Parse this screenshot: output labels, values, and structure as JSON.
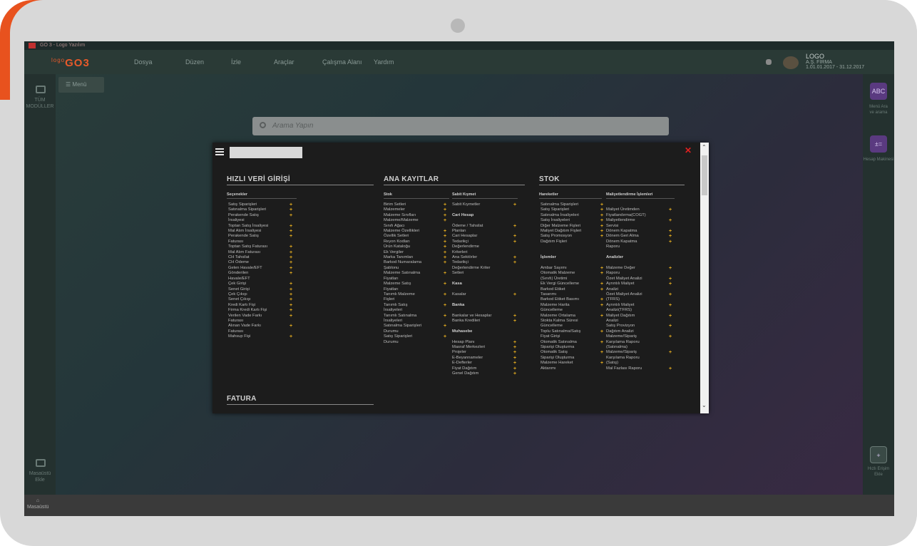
{
  "app": {
    "title": "GO 3 - Logo Yazılım",
    "logo_text": "GO3",
    "logo_prefix": "logo",
    "menu": [
      "Dosya",
      "Düzen",
      "İzle",
      "Araçlar",
      "Çalışma Alanı",
      "Yardım"
    ],
    "user": {
      "name": "LOGO",
      "company": "A.Ş. FİRMA",
      "date": "1.01.01.2017 - 31.12.2017"
    }
  },
  "leftbar": {
    "items": [
      {
        "label": "TÜM MODÜLLER",
        "icon": "monitor-icon"
      },
      {
        "label": "Masaüstü Ekle",
        "icon": "desktop-add-icon"
      }
    ]
  },
  "rightbar": {
    "items": [
      {
        "label": "Menü Ara",
        "sub": "ve arama",
        "icon": "abc-icon"
      },
      {
        "label": "Hesap Makinesi",
        "icon": "calculator-icon"
      },
      {
        "label": "Hızlı Erişim",
        "sub": "Ekle",
        "icon": "quick-add-icon"
      }
    ]
  },
  "menu_button": "Menü",
  "search": {
    "placeholder": "Arama Yapın"
  },
  "taskbar": {
    "home_label": "Masaüstü"
  },
  "modal": {
    "search_value": "",
    "sections": [
      {
        "title": "HIZLI VERİ GİRİŞİ",
        "columns": [
          {
            "heading": "Seçenekler",
            "items": [
              {
                "t": "Satış Siparişleri",
                "plus": true
              },
              {
                "t": "Satınalma Siparişleri",
                "plus": true
              },
              {
                "t": "Perakende Satış",
                "plus": true
              },
              {
                "t": "İrsaliyesi",
                "plus": false
              },
              {
                "t": "Toptan Satış İrsaliyesi",
                "plus": true
              },
              {
                "t": "Mal Alım İrsaliyesi",
                "plus": true
              },
              {
                "t": "Perakende Satış",
                "plus": true
              },
              {
                "t": "Faturası",
                "plus": false
              },
              {
                "t": "Toptan Satış Faturası",
                "plus": true
              },
              {
                "t": "Mal Alım Faturası",
                "plus": true
              },
              {
                "t": "CH Tahsilat",
                "plus": true
              },
              {
                "t": "CH Ödeme",
                "plus": true
              },
              {
                "t": "Gelen Havale/EFT",
                "plus": true
              },
              {
                "t": "Gönderilen",
                "plus": true
              },
              {
                "t": "Havale/EFT",
                "plus": false
              },
              {
                "t": "Çek Girişi",
                "plus": true
              },
              {
                "t": "Senet Girişi",
                "plus": true
              },
              {
                "t": "Çek Çıkışı",
                "plus": true
              },
              {
                "t": "Senet Çıkışı",
                "plus": true
              },
              {
                "t": "Kredi Kartı Fişi",
                "plus": true
              },
              {
                "t": "Firma Kredi Kartı Fişi",
                "plus": true
              },
              {
                "t": "Verilen Vade Farkı",
                "plus": true
              },
              {
                "t": "Faturası",
                "plus": false
              },
              {
                "t": "Alınan Vade Farkı",
                "plus": true
              },
              {
                "t": "Faturası",
                "plus": false
              },
              {
                "t": "Mahsup Fişi",
                "plus": true
              }
            ]
          }
        ]
      },
      {
        "title": "ANA KAYITLAR",
        "columns": [
          {
            "heading": "Stok",
            "items": [
              {
                "t": "Birim Setleri",
                "plus": true
              },
              {
                "t": "Malzemeler",
                "plus": true
              },
              {
                "t": "Malzeme Sınıfları",
                "plus": true
              },
              {
                "t": "Malzeme/Malzeme",
                "plus": true
              },
              {
                "t": "Sınıfı Ağacı",
                "plus": false
              },
              {
                "t": "Malzeme Özellikleri",
                "plus": true
              },
              {
                "t": "Özellik Setleri",
                "plus": true
              },
              {
                "t": "Reyon Kodları",
                "plus": true
              },
              {
                "t": "Ürün Kataloğu",
                "plus": true
              },
              {
                "t": "Ek Vergiler",
                "plus": true
              },
              {
                "t": "Marka Tanımları",
                "plus": true
              },
              {
                "t": "Barkod Numaralama",
                "plus": true
              },
              {
                "t": "Şablonu",
                "plus": false
              },
              {
                "t": "Malzeme Satınalma",
                "plus": true
              },
              {
                "t": "Fiyatları",
                "plus": false
              },
              {
                "t": "Malzeme Satış",
                "plus": true
              },
              {
                "t": "Fiyatları",
                "plus": false
              },
              {
                "t": "Tanımlı Malzeme",
                "plus": true
              },
              {
                "t": "Fişleri",
                "plus": false
              },
              {
                "t": "Tanımlı Satış",
                "plus": true
              },
              {
                "t": "İrsaliyeleri",
                "plus": false
              },
              {
                "t": "Tanımlı Satınalma",
                "plus": true
              },
              {
                "t": "İrsaliyeleri",
                "plus": false
              },
              {
                "t": "Satınalma Siparişleri",
                "plus": true
              },
              {
                "t": "Durumu",
                "plus": false
              },
              {
                "t": "Satış Siparişleri",
                "plus": true
              },
              {
                "t": "Durumu",
                "plus": false
              }
            ]
          },
          {
            "heading": "Sabit Kıymet",
            "items": [
              {
                "t": "Sabit Kıymetler",
                "plus": true
              },
              {
                "t": "",
                "plus": false
              },
              {
                "t": "Cari Hesap",
                "plus": false,
                "head": true
              },
              {
                "t": "",
                "plus": false
              },
              {
                "t": "Ödeme / Tahsilat",
                "plus": true
              },
              {
                "t": "Planları",
                "plus": false
              },
              {
                "t": "Cari Hesaplar",
                "plus": true
              },
              {
                "t": "Tedarikçi",
                "plus": true
              },
              {
                "t": "Değerlendirme",
                "plus": false
              },
              {
                "t": "Kriterleri",
                "plus": false
              },
              {
                "t": "Ana Sektörler",
                "plus": true
              },
              {
                "t": "Tedarikçi",
                "plus": true
              },
              {
                "t": "Değerlendirme Kriter",
                "plus": false
              },
              {
                "t": "Setleri",
                "plus": false
              },
              {
                "t": "",
                "plus": false
              },
              {
                "t": "Kasa",
                "plus": false,
                "head": true
              },
              {
                "t": "",
                "plus": false
              },
              {
                "t": "Kasalar",
                "plus": true
              },
              {
                "t": "",
                "plus": false
              },
              {
                "t": "Banka",
                "plus": false,
                "head": true
              },
              {
                "t": "",
                "plus": false
              },
              {
                "t": "Bankalar ve Hesaplar",
                "plus": true
              },
              {
                "t": "Banka Kredileri",
                "plus": true
              },
              {
                "t": "",
                "plus": false
              },
              {
                "t": "Muhasebe",
                "plus": false,
                "head": true
              },
              {
                "t": "",
                "plus": false
              },
              {
                "t": "Hesap Planı",
                "plus": true
              },
              {
                "t": "Masraf Merkezleri",
                "plus": true
              },
              {
                "t": "Projeler",
                "plus": true
              },
              {
                "t": "E-Beyannameler",
                "plus": true
              },
              {
                "t": "E-Defterler",
                "plus": true
              },
              {
                "t": "Fiyat Dağıtım",
                "plus": true
              },
              {
                "t": "Genel Dağıtım",
                "plus": true
              }
            ]
          }
        ]
      },
      {
        "title": "STOK",
        "columns": [
          {
            "heading": "Hareketler",
            "items": [
              {
                "t": "Satınalma Siparişleri",
                "plus": true
              },
              {
                "t": "Satış Siparişleri",
                "plus": true
              },
              {
                "t": "Satınalma İrsaliyeleri",
                "plus": true
              },
              {
                "t": "Satış İrsaliyeleri",
                "plus": true
              },
              {
                "t": "Diğer Malzeme Fişleri",
                "plus": true
              },
              {
                "t": "Maliyet Dağıtım Fişleri",
                "plus": true
              },
              {
                "t": "Satış Promosyon",
                "plus": true
              },
              {
                "t": "Dağıtım Fişleri",
                "plus": false
              },
              {
                "t": "",
                "plus": false
              },
              {
                "t": "",
                "plus": false
              },
              {
                "t": "İşlemler",
                "plus": false,
                "head": true
              },
              {
                "t": "",
                "plus": false
              },
              {
                "t": "Ambar Sayımı",
                "plus": true
              },
              {
                "t": "Otomatik Malzeme",
                "plus": true
              },
              {
                "t": "(Sınıfı) Üretimi",
                "plus": false
              },
              {
                "t": "Ek Vergi Güncelleme",
                "plus": true
              },
              {
                "t": "Barkod Etiket",
                "plus": true
              },
              {
                "t": "Tasarımı",
                "plus": false
              },
              {
                "t": "Barkod Etiket Basımı",
                "plus": true
              },
              {
                "t": "Malzeme Harita",
                "plus": true
              },
              {
                "t": "Güncelleme",
                "plus": false
              },
              {
                "t": "Malzeme Ortalama",
                "plus": true
              },
              {
                "t": "Stokta Kalma Süresi",
                "plus": false
              },
              {
                "t": "Güncelleme",
                "plus": false
              },
              {
                "t": "Toplu Satınalma/Satış",
                "plus": true
              },
              {
                "t": "Fiyat Girişi",
                "plus": false
              },
              {
                "t": "Otomatik Satınalma",
                "plus": true
              },
              {
                "t": "Siparişi Oluşturma",
                "plus": false
              },
              {
                "t": "Otomatik Satış",
                "plus": true
              },
              {
                "t": "Siparişi Oluşturma",
                "plus": false
              },
              {
                "t": "Malzeme Hareket",
                "plus": true
              },
              {
                "t": "Aktarımı",
                "plus": false
              }
            ]
          },
          {
            "heading": "Maliyetlendirme İşlemleri",
            "items": [
              {
                "t": "",
                "plus": false
              },
              {
                "t": "Maliyet Üretimden",
                "plus": true
              },
              {
                "t": "Fiyatlandırma(COGT)",
                "plus": false
              },
              {
                "t": "Maliyetlendirme",
                "plus": true
              },
              {
                "t": "Servisi",
                "plus": false
              },
              {
                "t": "Dönem Kapatma",
                "plus": true
              },
              {
                "t": "Dönem Geri Alma",
                "plus": true
              },
              {
                "t": "Dönem Kapatma",
                "plus": true
              },
              {
                "t": "Raporu",
                "plus": false
              },
              {
                "t": "",
                "plus": false
              },
              {
                "t": "Analizler",
                "plus": false,
                "head": true
              },
              {
                "t": "",
                "plus": false
              },
              {
                "t": "Malzeme Değer",
                "plus": true
              },
              {
                "t": "Raporu",
                "plus": false
              },
              {
                "t": "Özet Maliyet Analizi",
                "plus": true
              },
              {
                "t": "Ayrıntılı Maliyet",
                "plus": true
              },
              {
                "t": "Analizi",
                "plus": false
              },
              {
                "t": "Özet Maliyet Analizi",
                "plus": true
              },
              {
                "t": "(TFRS)",
                "plus": false
              },
              {
                "t": "Ayrıntılı Maliyet",
                "plus": true
              },
              {
                "t": "Analizi(TFRS)",
                "plus": false
              },
              {
                "t": "Maliyet Dağıtım",
                "plus": true
              },
              {
                "t": "Analizi",
                "plus": false
              },
              {
                "t": "Satış Provizyon",
                "plus": true
              },
              {
                "t": "Dağıtım Analizi",
                "plus": false
              },
              {
                "t": "Malzeme/Sipariş",
                "plus": true
              },
              {
                "t": "Karşılama Raporu",
                "plus": false
              },
              {
                "t": "(Satınalma)",
                "plus": false
              },
              {
                "t": "Malzeme/Sipariş",
                "plus": true
              },
              {
                "t": "Karşılama Raporu",
                "plus": false
              },
              {
                "t": "(Satış)",
                "plus": false
              },
              {
                "t": "Mal Fazlası Raporu",
                "plus": true
              }
            ]
          }
        ]
      },
      {
        "title": "FATURA",
        "columns": []
      }
    ]
  }
}
